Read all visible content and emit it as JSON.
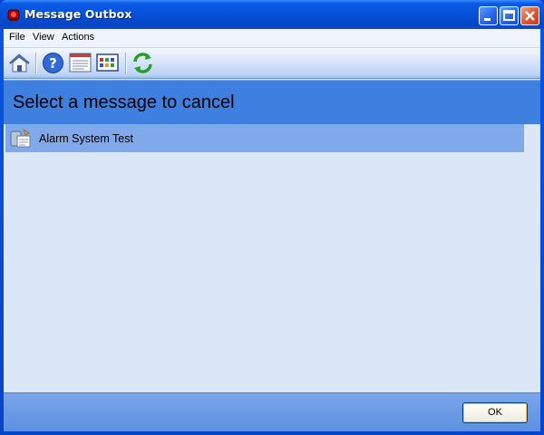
{
  "window": {
    "title": "Message Outbox"
  },
  "menu": {
    "items": [
      "File",
      "View",
      "Actions"
    ]
  },
  "toolbar": {
    "icons": [
      "home-icon",
      "help-icon",
      "report-icon",
      "grid-icon",
      "refresh-icon"
    ]
  },
  "header": {
    "text": "Select a message to cancel"
  },
  "messages": [
    {
      "label": "Alarm System Test",
      "icon": "message-icon"
    }
  ],
  "footer": {
    "ok_label": "OK"
  },
  "colors": {
    "header": "#3d80e0",
    "selected_row": "#7fa9ea",
    "client_bg": "#dbe6f7"
  }
}
